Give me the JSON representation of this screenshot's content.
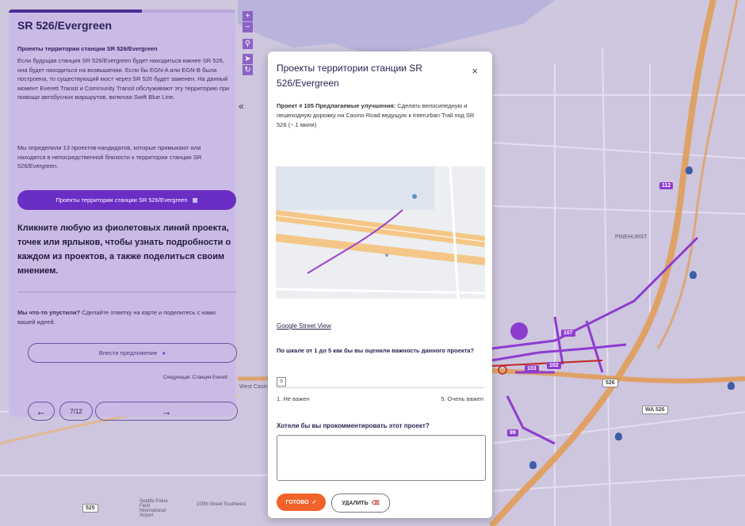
{
  "map": {
    "labels": {
      "pinehurst": "PINEHURST",
      "west_casino": "West Casino",
      "airport": "Seattle Paine Field International Airport",
      "street_100th": "100th Street Southwest"
    },
    "shields": {
      "s107": "107",
      "s102": "102",
      "s103": "103",
      "s112": "112",
      "s99": "99",
      "s526": "526",
      "sr526": "WA 526",
      "s525": "525"
    },
    "zoom_in": "+",
    "zoom_out": "−",
    "accent": "#8e3cd0"
  },
  "panel": {
    "title": "SR 526/Evergreen",
    "subtitle": "Проекты территории станции SR 526/Evergreen",
    "para1": "Если будущая станция SR 526/Evergreen будет находиться южнее SR 526, она будет находиться на возвышении. Если бы EGN-A или EGN-B была построена, то существующий мост через SR 526 будет заменен. На данный момент Everett Transit и Community Transit обслуживают эту территорию при помощи автобусных маршрутов, включая Swift Blue Line.",
    "para2": "Мы определили 13 проектов-кандидатов, которые примыкают или находятся в непосредственной близости к территории станции SR 526/Evergreen.",
    "projects_button": "Проекты территории станции SR 526/Evergreen",
    "big_text": "Кликните любую из фиолетовых линий проекта, точек или ярлыков, чтобы узнать подробности о каждом из проектов, а также поделиться своим мнением.",
    "missed_bold": "Мы что-то упустили?",
    "missed_text": " Сделайте отметку на карте и поделитесь с нами вашей идеей.",
    "suggest_button": "Внести предложение",
    "next_label": "Следующая: Станция Everett",
    "counter": "7/12",
    "prev_arrow": "←",
    "next_arrow": "→",
    "collapse": "«"
  },
  "modal": {
    "title": "Проекты территории станции SR 526/Evergreen",
    "close": "×",
    "desc_bold": "Проект # 105 Предлагаемые улучшения:",
    "desc_text": " Сделать велосипедную и пешеходную дорожку на Casino Road ведущую к Interurban Trail под SR 526 (~.1 мили)",
    "street_view_link": "Google Street View",
    "rating_question": "По шкале от 1 до 5 как бы вы оценили важность данного проекта?",
    "rating_value": "0",
    "rating_low": "1. Не важен",
    "rating_high": "5. Очень важен",
    "comment_question": "Хотели бы вы прокомментировать этот проект?",
    "comment_value": "",
    "ok_button": "ГОТОВО",
    "delete_button": "УДАЛИТЬ"
  }
}
